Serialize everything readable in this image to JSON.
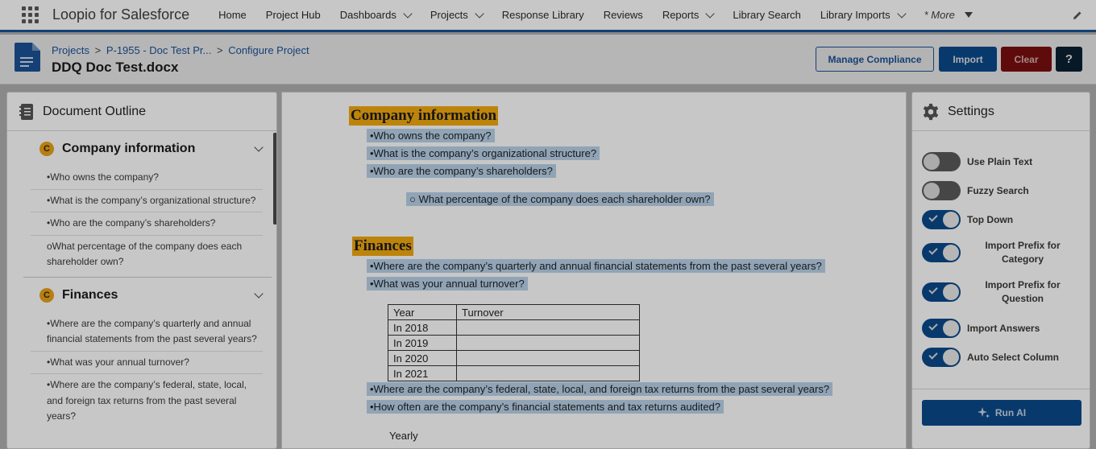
{
  "topnav": {
    "app_name": "Loopio for Salesforce",
    "items": [
      {
        "label": "Home",
        "has_dropdown": false
      },
      {
        "label": "Project Hub",
        "has_dropdown": false
      },
      {
        "label": "Dashboards",
        "has_dropdown": true
      },
      {
        "label": "Projects",
        "has_dropdown": true
      },
      {
        "label": "Response Library",
        "has_dropdown": false
      },
      {
        "label": "Reviews",
        "has_dropdown": false
      },
      {
        "label": "Reports",
        "has_dropdown": true
      },
      {
        "label": "Library Search",
        "has_dropdown": false
      },
      {
        "label": "Library Imports",
        "has_dropdown": true
      }
    ],
    "more_label": "* More"
  },
  "header": {
    "breadcrumb": [
      "Projects",
      "P-1955 - Doc Test Pr...",
      "Configure Project"
    ],
    "breadcrumb_sep": ">",
    "title": "DDQ Doc Test.docx",
    "buttons": {
      "manage": "Manage Compliance",
      "import": "Import",
      "clear": "Clear",
      "help": "?"
    }
  },
  "outline": {
    "title": "Document Outline",
    "sections": [
      {
        "badge": "C",
        "title": "Company information",
        "items": [
          "•Who owns the company?",
          "•What is the company’s organizational structure?",
          "•Who are the company’s shareholders?",
          "oWhat percentage of the company does each shareholder own?"
        ]
      },
      {
        "badge": "C",
        "title": "Finances",
        "items": [
          "•Where are the company’s quarterly and annual financial statements from the past several years?",
          "•What was your annual turnover?",
          "•Where are the company’s federal, state, local, and foreign tax returns from the past several years?"
        ]
      }
    ]
  },
  "document": {
    "heading1": "Company information",
    "q1": "•Who owns the company?",
    "q2": "•What is the company’s organizational structure?",
    "q3": "•Who are the company’s shareholders?",
    "q4": "○ What percentage of the company does each shareholder own?",
    "heading2": "Finances",
    "q5": "•Where are the company’s quarterly and annual financial statements from the past several years?",
    "q6": "•What was your annual turnover?",
    "table": {
      "headers": [
        "Year",
        "Turnover"
      ],
      "rows": [
        [
          "In 2018",
          ""
        ],
        [
          "In 2019",
          ""
        ],
        [
          "In 2020",
          ""
        ],
        [
          "In 2021",
          ""
        ]
      ]
    },
    "q7": "•Where are the company’s federal, state, local, and foreign tax returns from the past several years?",
    "q8": "•How often are the company’s financial statements and tax returns audited?",
    "trailing": "Yearly"
  },
  "settings": {
    "title": "Settings",
    "toggles": [
      {
        "label": "Use Plain Text",
        "on": false
      },
      {
        "label": "Fuzzy Search",
        "on": false
      },
      {
        "label": "Top Down",
        "on": true
      },
      {
        "label": "Import Prefix for Category",
        "on": true
      },
      {
        "label": "Import Prefix for Question",
        "on": true
      },
      {
        "label": "Import Answers",
        "on": true
      },
      {
        "label": "Auto Select Column",
        "on": true
      }
    ],
    "run_ai": "Run AI"
  },
  "colors": {
    "brand": "#1b5297",
    "heading_highlight": "#f2aa0f",
    "question_highlight": "#b9d3ea",
    "clear_button": "#7a0f10"
  }
}
